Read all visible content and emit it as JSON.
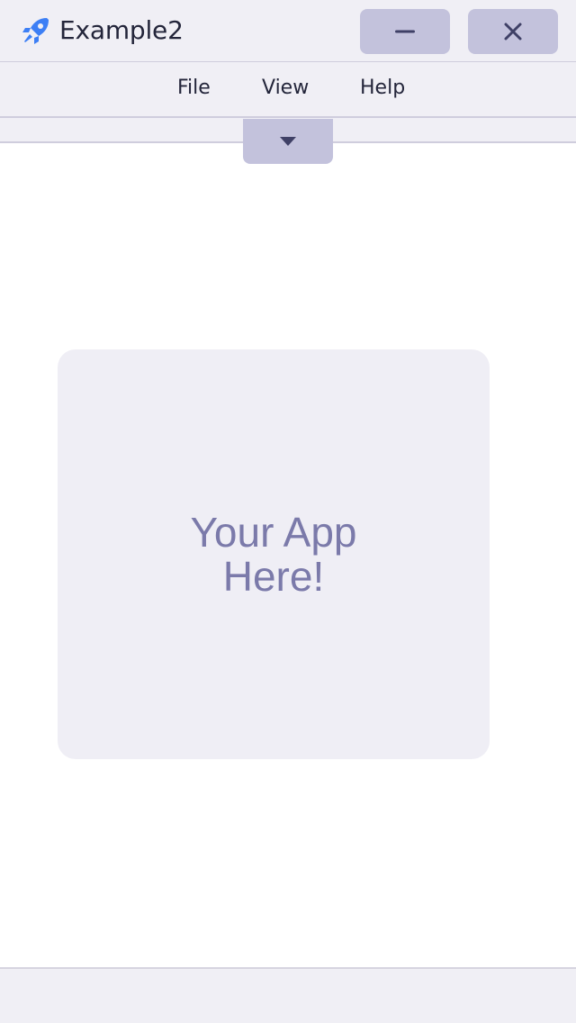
{
  "window": {
    "title": "Example2",
    "app_icon": "rocket-icon",
    "minimize_icon": "minus-icon",
    "close_icon": "close-icon"
  },
  "menu": {
    "items": [
      {
        "label": "File"
      },
      {
        "label": "View"
      },
      {
        "label": "Help"
      }
    ]
  },
  "toolbar": {
    "toggle_icon": "caret-down-icon"
  },
  "main": {
    "placeholder_text": "Your App Here!"
  },
  "colors": {
    "chrome_background": "#f0eff5",
    "button_background": "#c3c2dc",
    "icon_color": "#3f4066",
    "rocket_blue": "#3d7ff5",
    "placeholder_text": "#7b7aaa",
    "card_background": "#efeef5"
  }
}
